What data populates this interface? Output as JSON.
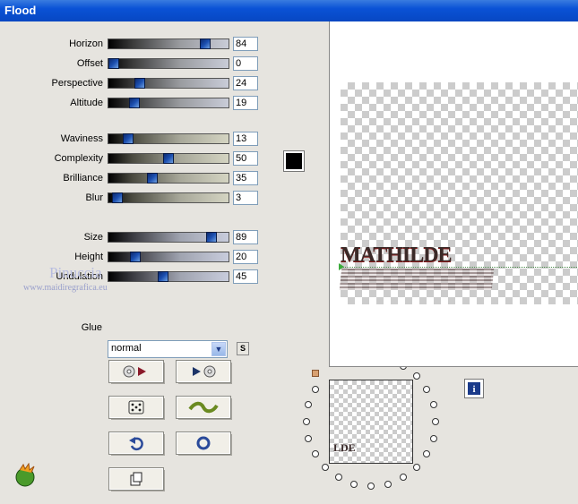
{
  "window": {
    "title": "Flood"
  },
  "sliders_group1": [
    {
      "label": "Horizon",
      "value": "84",
      "pct": 84
    },
    {
      "label": "Offset",
      "value": "0",
      "pct": 0
    },
    {
      "label": "Perspective",
      "value": "24",
      "pct": 24
    },
    {
      "label": "Altitude",
      "value": "19",
      "pct": 19
    }
  ],
  "sliders_group2": [
    {
      "label": "Waviness",
      "value": "13",
      "pct": 13
    },
    {
      "label": "Complexity",
      "value": "50",
      "pct": 50
    },
    {
      "label": "Brilliance",
      "value": "35",
      "pct": 35
    },
    {
      "label": "Blur",
      "value": "3",
      "pct": 3
    }
  ],
  "sliders_group3": [
    {
      "label": "Size",
      "value": "89",
      "pct": 89
    },
    {
      "label": "Height",
      "value": "20",
      "pct": 20
    },
    {
      "label": "Undulation",
      "value": "45",
      "pct": 45
    }
  ],
  "color_swatch": "#000000",
  "glue": {
    "label": "Glue",
    "value": "normal",
    "s_button": "S"
  },
  "watermark": {
    "name": "Pinuccia",
    "url": "www.maidiregrafica.eu"
  },
  "preview": {
    "text": "MATHILDE",
    "thumb_text": "LDE"
  },
  "icons": {
    "buttons": [
      "play-forward-icon",
      "play-backward-icon",
      "dice-icon",
      "wave-icon",
      "undo-icon",
      "reset-icon",
      "copy-icon"
    ],
    "info": "info-icon",
    "logo": "plugin-logo-icon"
  }
}
